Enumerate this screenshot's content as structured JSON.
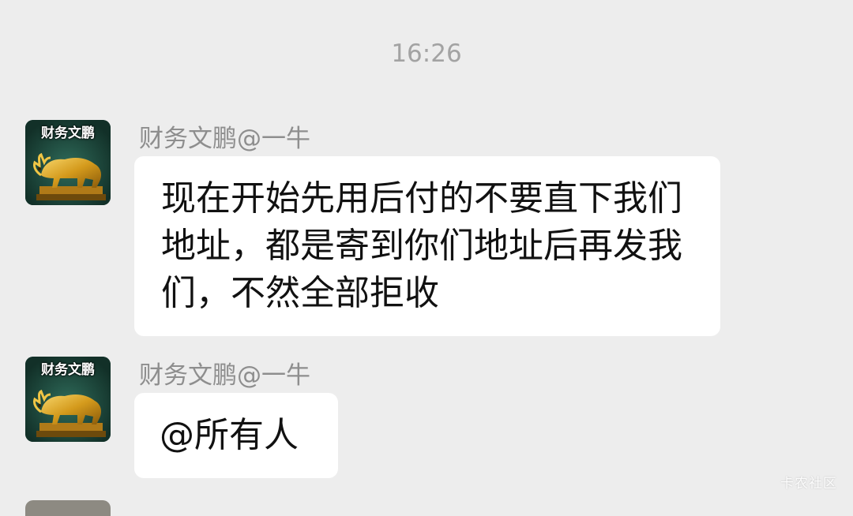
{
  "chat": {
    "timestamp": "16:26",
    "messages": [
      {
        "sender": "财务文鹏@一牛",
        "avatar_caption": "财务文鹏",
        "text": "现在开始先用后付的不要直下我们地址，都是寄到你们地址后再发我们，不然全部拒收"
      },
      {
        "sender": "财务文鹏@一牛",
        "avatar_caption": "财务文鹏",
        "text": "@所有人"
      }
    ]
  },
  "watermark": "卡农社区",
  "colors": {
    "background": "#ededed",
    "bubble": "#ffffff",
    "timestamp_text": "#a3a3a3",
    "sender_text": "#8e8e8e",
    "message_text": "#111111",
    "avatar_bg": "#1d4a3e",
    "avatar_gold": "#d9a521"
  },
  "icons": {
    "avatar": "golden-bull-avatar-icon"
  }
}
